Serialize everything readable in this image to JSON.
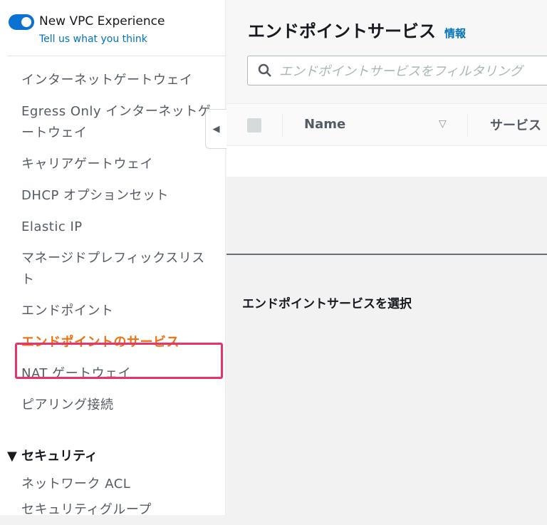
{
  "sidebar": {
    "experience_title": "New VPC Experience",
    "feedback_link": "Tell us what you think",
    "items": [
      {
        "label": "インターネットゲートウェイ"
      },
      {
        "label": "Egress Only インターネットゲートウェイ"
      },
      {
        "label": "キャリアゲートウェイ"
      },
      {
        "label": "DHCP オプションセット"
      },
      {
        "label": "Elastic IP"
      },
      {
        "label": "マネージドプレフィックスリスト"
      },
      {
        "label": "エンドポイント"
      },
      {
        "label": "エンドポイントのサービス"
      },
      {
        "label": "NAT ゲートウェイ"
      },
      {
        "label": "ピアリング接続"
      }
    ],
    "section": "▼ セキュリティ",
    "section_items": [
      {
        "label": "ネットワーク ACL"
      },
      {
        "label": "セキュリティグループ"
      }
    ]
  },
  "main": {
    "title": "エンドポイントサービス",
    "info": "情報",
    "search_placeholder": "エンドポイントサービスをフィルタリング",
    "columns": [
      "Name",
      "サービス"
    ],
    "empty_detail": "エンドポイントサービスを選択"
  }
}
